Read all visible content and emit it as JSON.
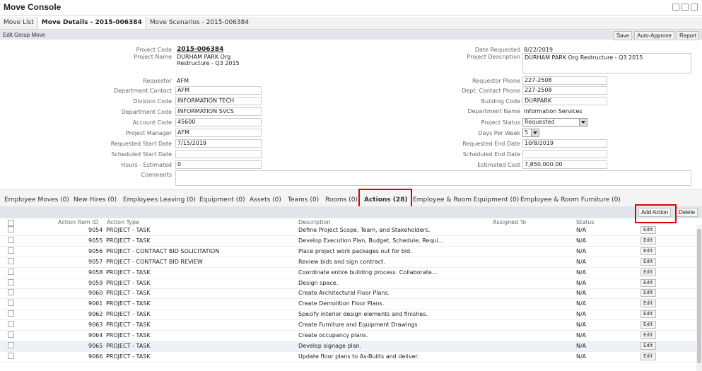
{
  "app": {
    "title": "Move Console"
  },
  "tabs": [
    {
      "label": "Move List"
    },
    {
      "label": "Move Details - 2015-006384"
    },
    {
      "label": "Move Scenarios - 2015-006384"
    }
  ],
  "group_bar": {
    "title": "Edit Group Move",
    "save": "Save",
    "auto_approve": "Auto-Approve",
    "report": "Report"
  },
  "form": {
    "project_code_label": "Project Code",
    "project_code": "2015-006384",
    "project_name_label": "Project Name",
    "project_name_1": "DURHAM PARK Org",
    "project_name_2": "Restructure - Q3 2015",
    "date_requested_label": "Date Requested",
    "date_requested": "8/22/2019",
    "project_description_label": "Project Description",
    "project_description": "DURHAM PARK Org Restructure - Q3 2015",
    "requestor_label": "Requestor",
    "requestor": "AFM",
    "requestor_phone_label": "Requestor Phone",
    "requestor_phone": "227-2508",
    "dept_contact_label": "Department Contact",
    "dept_contact": "AFM",
    "dept_contact_phone_label": "Dept. Contact Phone",
    "dept_contact_phone": "227-2508",
    "division_code_label": "Division Code",
    "division_code": "INFORMATION TECH",
    "building_code_label": "Building Code",
    "building_code": "DURPARK",
    "department_code_label": "Department Code",
    "department_code": "INFORMATION SVCS",
    "department_name_label": "Department Name",
    "department_name": "Information Services",
    "account_code_label": "Account Code",
    "account_code": "45600",
    "project_status_label": "Project Status",
    "project_status": "Requested",
    "project_manager_label": "Project Manager",
    "project_manager": "AFM",
    "days_per_week_label": "Days Per Week",
    "days_per_week": "5",
    "requested_start_label": "Requested Start Date",
    "requested_start": "7/15/2019",
    "requested_end_label": "Requested End Date",
    "requested_end": "10/8/2019",
    "scheduled_start_label": "Scheduled Start Date",
    "scheduled_start": "",
    "scheduled_end_label": "Scheduled End Date",
    "scheduled_end": "",
    "hours_label": "Hours - Estimated",
    "hours": "0",
    "estimated_cost_label": "Estimated Cost",
    "estimated_cost": "7,850,000.00",
    "comments_label": "Comments"
  },
  "subtabs": [
    "Employee Moves (0)",
    "New Hires (0)",
    "Employees Leaving (0)",
    "Equipment (0)",
    "Assets (0)",
    "Teams (0)",
    "Rooms (0)",
    "Actions (28)",
    "Employee & Room Equipment (0)",
    "Employee & Room Furniture (0)"
  ],
  "grid": {
    "add_action": "Add Action",
    "delete": "Delete",
    "headers": {
      "id": "Action Item ID",
      "type": "Action Type",
      "description": "Description",
      "assigned": "Assigned To",
      "status": "Status"
    },
    "edit_label": "Edit",
    "rows": [
      {
        "id": "9054",
        "type": "PROJECT - TASK",
        "description": "Define Project Scope, Team, and Stakeholders.",
        "status": "N/A"
      },
      {
        "id": "9055",
        "type": "PROJECT - TASK",
        "description": "Develop Execution Plan, Budget, Schedule, Requi...",
        "status": "N/A"
      },
      {
        "id": "9056",
        "type": "PROJECT - CONTRACT BID SOLICITATION",
        "description": "Place project work packages out for bid.",
        "status": "N/A"
      },
      {
        "id": "9057",
        "type": "PROJECT - CONTRACT BID REVIEW",
        "description": "Review bids and sign contract.",
        "status": "N/A"
      },
      {
        "id": "9058",
        "type": "PROJECT - TASK",
        "description": "Coordinate entire building process. Collaborate...",
        "status": "N/A"
      },
      {
        "id": "9059",
        "type": "PROJECT - TASK",
        "description": "Design space.",
        "status": "N/A"
      },
      {
        "id": "9060",
        "type": "PROJECT - TASK",
        "description": "Create Architectural Floor Plans.",
        "status": "N/A"
      },
      {
        "id": "9061",
        "type": "PROJECT - TASK",
        "description": "Create Demolition Floor Plans.",
        "status": "N/A"
      },
      {
        "id": "9062",
        "type": "PROJECT - TASK",
        "description": "Specify interior design elements and finishes.",
        "status": "N/A"
      },
      {
        "id": "9063",
        "type": "PROJECT - TASK",
        "description": "Create Furniture and Equipment Drawings",
        "status": "N/A"
      },
      {
        "id": "9064",
        "type": "PROJECT - TASK",
        "description": "Create occupancy plans.",
        "status": "N/A"
      },
      {
        "id": "9065",
        "type": "PROJECT - TASK",
        "description": "Develop signage plan.",
        "status": "N/A"
      },
      {
        "id": "9066",
        "type": "PROJECT - TASK",
        "description": "Update floor plans to As-Builts and deliver.",
        "status": "N/A"
      }
    ]
  }
}
